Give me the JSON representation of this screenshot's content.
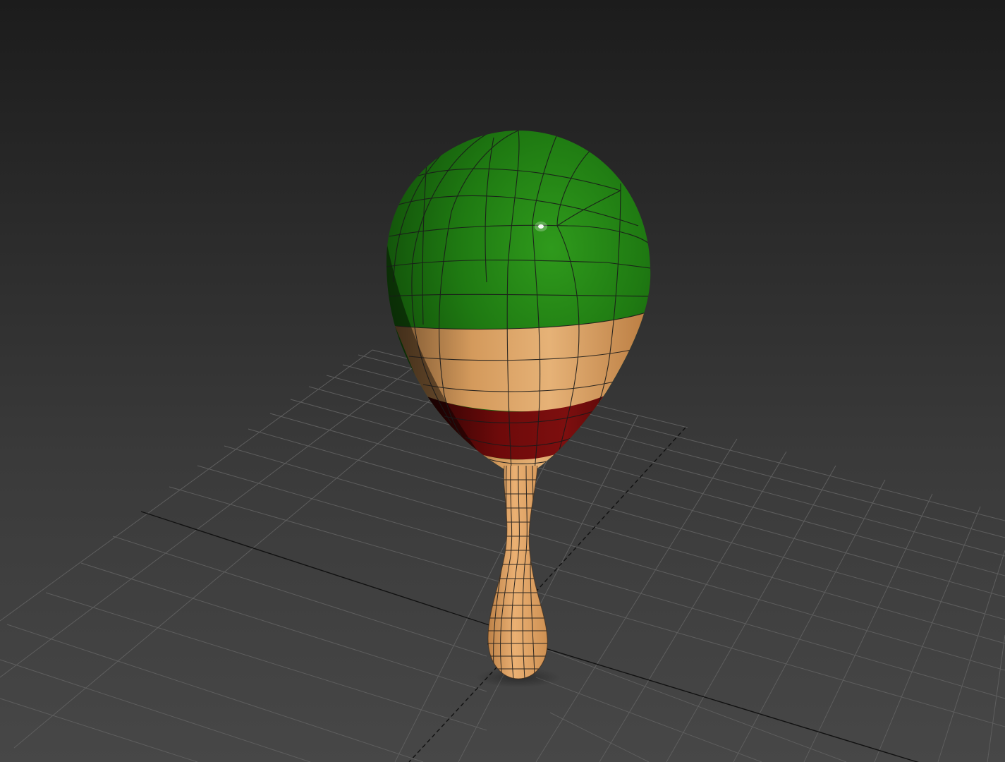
{
  "viewport": {
    "background_top": "#1c1c1c",
    "background_bottom": "#474747",
    "grid_color": "#5e5e5e",
    "axis_color": "#111111"
  },
  "model": {
    "object": "maraca",
    "colors": {
      "head_green": "#1f7a12",
      "band_tan": "#d9a366",
      "band_red": "#7a0d0d",
      "handle_tan": "#e2a462",
      "wire": "#1a1a1a"
    }
  }
}
